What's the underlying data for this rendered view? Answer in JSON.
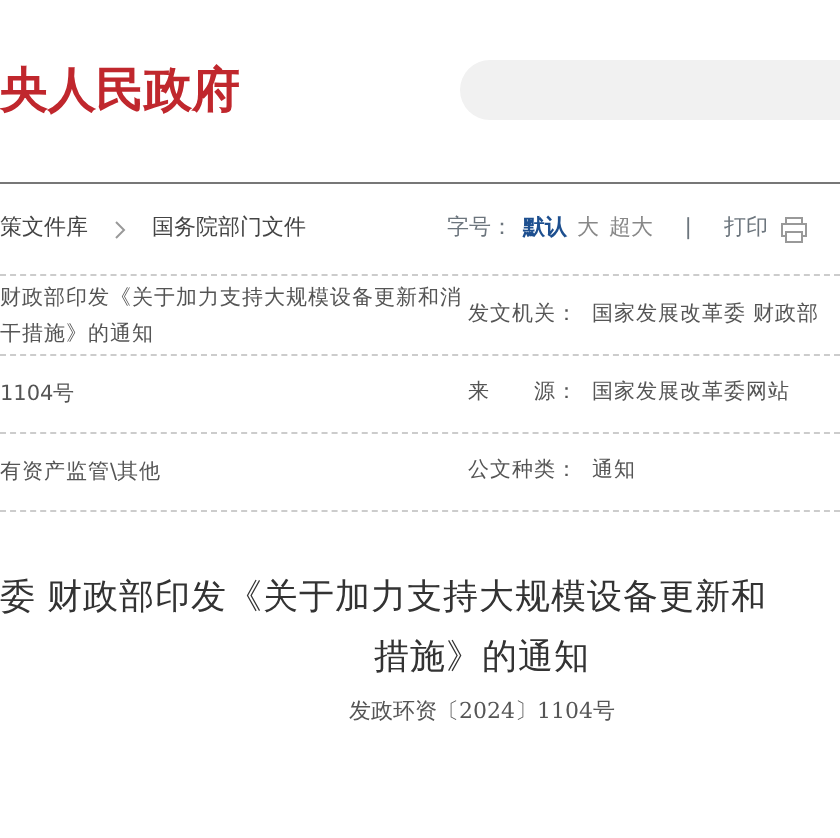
{
  "header": {
    "logo": "央人民政府"
  },
  "breadcrumb": [
    {
      "label": "策文件库"
    },
    {
      "label": "国务院部门文件"
    }
  ],
  "toolbar": {
    "font_size_label": "字号：",
    "sizes": [
      {
        "label": "默认",
        "selected": true
      },
      {
        "label": "大",
        "selected": false
      },
      {
        "label": "超大",
        "selected": false
      }
    ],
    "separator": "|",
    "print": "打印"
  },
  "meta": [
    {
      "left": [
        "财政部印发《关于加力支持大规模设备更新和消",
        "干措施》的通知"
      ],
      "label": "发文机关：",
      "value": "国家发展改革委 财政部"
    },
    {
      "left": [
        "1104号"
      ],
      "label": "来　　源：",
      "value": "国家发展改革委网站"
    },
    {
      "left": [
        "有资产监管\\其他"
      ],
      "label": "公文种类：",
      "value": "通知"
    }
  ],
  "title": [
    "委 财政部印发《关于加力支持大规模设备更新和",
    "措施》的通知"
  ],
  "doc_number": "发政环资〔2024〕1104号"
}
